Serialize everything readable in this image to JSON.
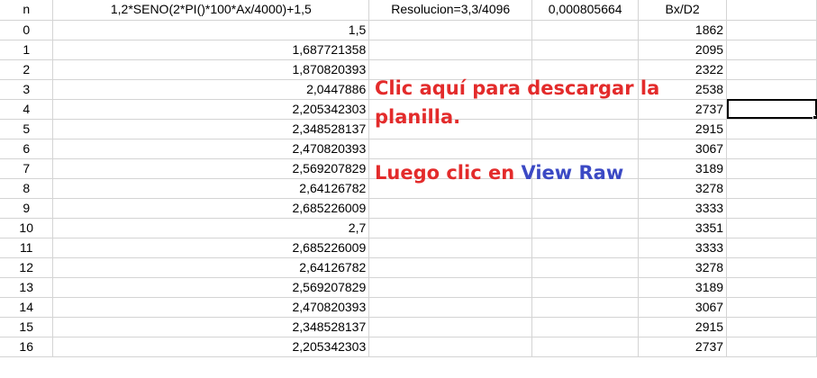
{
  "header": {
    "col_a": "n",
    "col_b": "1,2*SENO(2*PI()*100*Ax/4000)+1,5",
    "col_c": "Resolucion=3,3/4096",
    "col_d": "0,000805664",
    "col_e": "Bx/D2"
  },
  "rows": [
    {
      "n": "0",
      "value": "1,5",
      "bx": "1862"
    },
    {
      "n": "1",
      "value": "1,687721358",
      "bx": "2095"
    },
    {
      "n": "2",
      "value": "1,870820393",
      "bx": "2322"
    },
    {
      "n": "3",
      "value": "2,0447886",
      "bx": "2538"
    },
    {
      "n": "4",
      "value": "2,205342303",
      "bx": "2737"
    },
    {
      "n": "5",
      "value": "2,348528137",
      "bx": "2915"
    },
    {
      "n": "6",
      "value": "2,470820393",
      "bx": "3067"
    },
    {
      "n": "7",
      "value": "2,569207829",
      "bx": "3189"
    },
    {
      "n": "8",
      "value": "2,64126782",
      "bx": "3278"
    },
    {
      "n": "9",
      "value": "2,685226009",
      "bx": "3333"
    },
    {
      "n": "10",
      "value": "2,7",
      "bx": "3351"
    },
    {
      "n": "11",
      "value": "2,685226009",
      "bx": "3333"
    },
    {
      "n": "12",
      "value": "2,64126782",
      "bx": "3278"
    },
    {
      "n": "13",
      "value": "2,569207829",
      "bx": "3189"
    },
    {
      "n": "14",
      "value": "2,470820393",
      "bx": "3067"
    },
    {
      "n": "15",
      "value": "2,348528137",
      "bx": "2915"
    },
    {
      "n": "16",
      "value": "2,205342303",
      "bx": "2737"
    }
  ],
  "overlay": {
    "download_text": "Clic aquí para descargar la planilla.",
    "then_text": "Luego clic en ",
    "view_raw": "View Raw"
  },
  "colors": {
    "overlay_red": "#e32b2b",
    "overlay_blue": "#3b49c4",
    "gridline": "#d4d4d4"
  }
}
